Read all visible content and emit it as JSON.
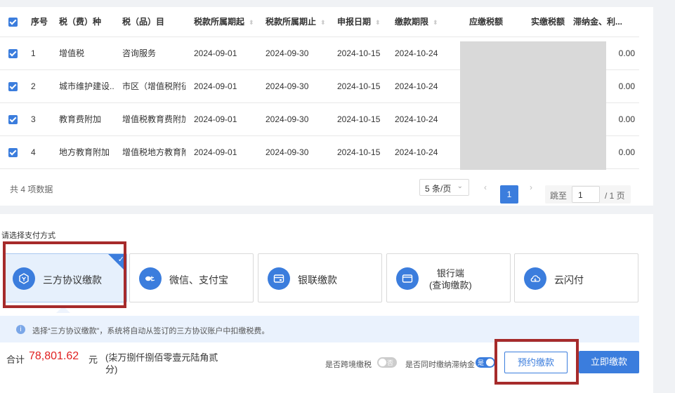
{
  "table": {
    "headers": {
      "seq": "序号",
      "tax_type": "税（费）种",
      "tax_item": "税（品）目",
      "period_start": "税款所属期起",
      "period_end": "税款所属期止",
      "declare_date": "申报日期",
      "deadline": "缴款期限",
      "payable": "应缴税额",
      "paid": "实缴税额",
      "late_fee": "滞纳金、利..."
    },
    "rows": [
      {
        "seq": "1",
        "tax_type": "增值税",
        "tax_item": "咨询服务",
        "period_start": "2024-09-01",
        "period_end": "2024-09-30",
        "declare_date": "2024-10-15",
        "deadline": "2024-10-24",
        "late_fee": "0.00"
      },
      {
        "seq": "2",
        "tax_type": "城市维护建设...",
        "tax_item": "市区（增值税附征",
        "period_start": "2024-09-01",
        "period_end": "2024-09-30",
        "declare_date": "2024-10-15",
        "deadline": "2024-10-24",
        "late_fee": "0.00"
      },
      {
        "seq": "3",
        "tax_type": "教育费附加",
        "tax_item": "增值税教育费附加",
        "period_start": "2024-09-01",
        "period_end": "2024-09-30",
        "declare_date": "2024-10-15",
        "deadline": "2024-10-24",
        "late_fee": "0.00"
      },
      {
        "seq": "4",
        "tax_type": "地方教育附加",
        "tax_item": "增值税地方教育附",
        "period_start": "2024-09-01",
        "period_end": "2024-09-30",
        "declare_date": "2024-10-15",
        "deadline": "2024-10-24",
        "late_fee": "0.00"
      }
    ]
  },
  "pagination": {
    "total_text": "共 4 项数据",
    "page_size": "5 条/页",
    "current_page": "1",
    "goto_label": "跳至",
    "goto_value": "1",
    "total_pages": "/ 1 页"
  },
  "payment": {
    "title": "请选择支付方式",
    "methods": [
      {
        "label": "三方协议缴款",
        "icon": "hexagon-icon",
        "selected": true
      },
      {
        "label": "微信、支付宝",
        "icon": "wechat-alipay-icon"
      },
      {
        "label": "银联缴款",
        "icon": "card-icon"
      },
      {
        "label_line1": "银行端",
        "label_line2": "(查询缴款)",
        "icon": "wallet-icon"
      },
      {
        "label": "云闪付",
        "icon": "cloud-icon"
      }
    ],
    "notice": "选择“三方协议缴款”，系统将自动从签订的三方协议账户中扣缴税费。",
    "info_glyph": "i"
  },
  "summary": {
    "total_label": "合计",
    "amount": "78,801.62",
    "unit": "元",
    "amount_words": "(柒万捌仟捌佰零壹元陆角贰分)"
  },
  "toggles": {
    "cross_border_label": "是否跨境缴税",
    "cross_border_state": "否",
    "late_fee_label": "是否同时缴纳滞纳金",
    "late_fee_state": "是"
  },
  "buttons": {
    "reserve": "预约缴款",
    "pay_now": "立即缴款"
  },
  "colors": {
    "accent": "#3b7ddd",
    "amount": "#e02020",
    "highlight_box": "#a62b2b"
  }
}
